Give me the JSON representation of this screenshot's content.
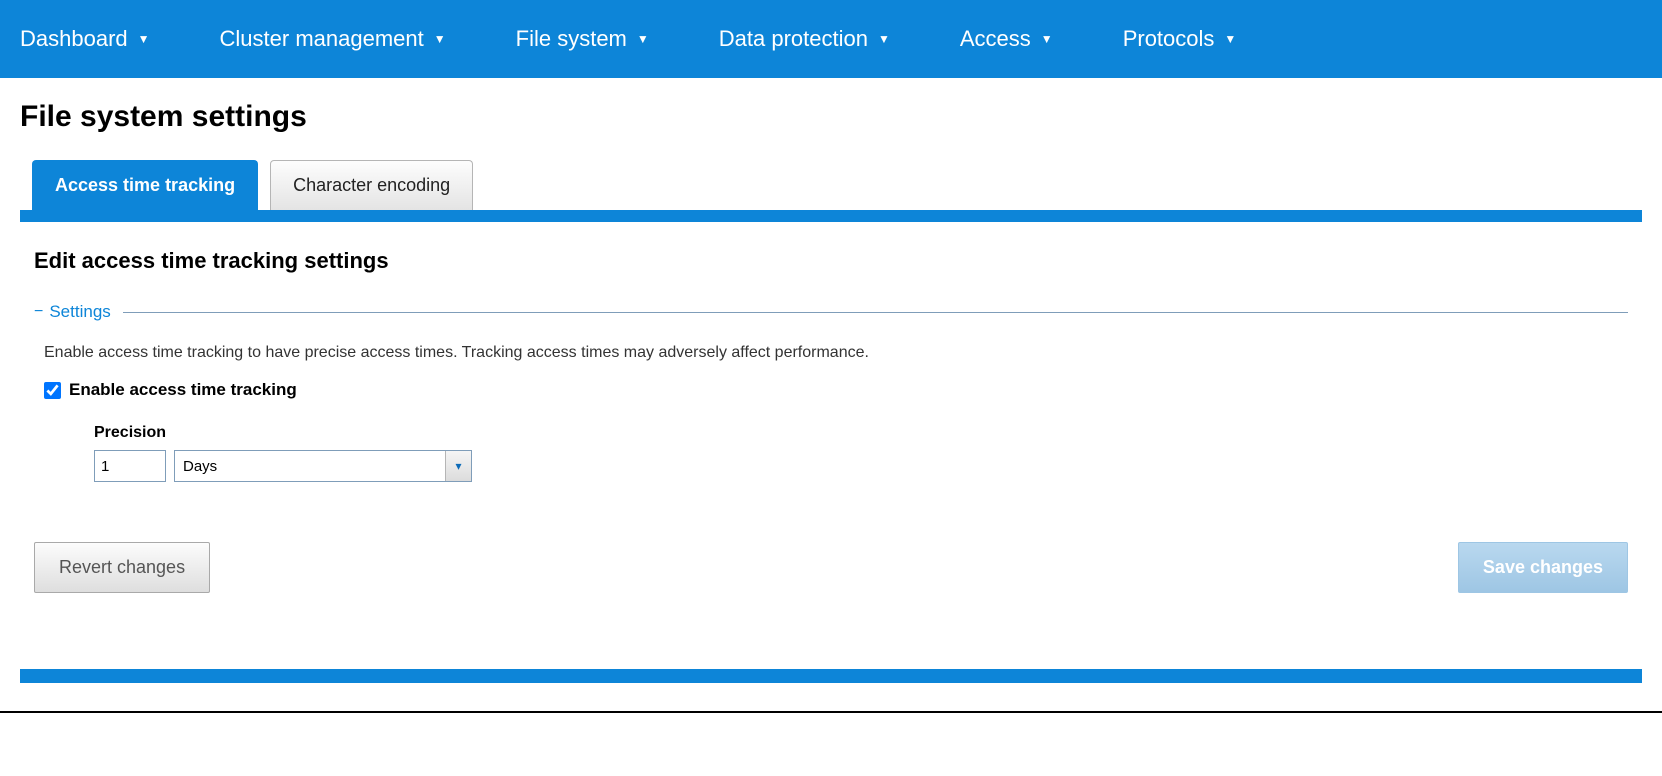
{
  "nav": {
    "items": [
      {
        "label": "Dashboard"
      },
      {
        "label": "Cluster management"
      },
      {
        "label": "File system"
      },
      {
        "label": "Data protection"
      },
      {
        "label": "Access"
      },
      {
        "label": "Protocols"
      }
    ]
  },
  "page": {
    "title": "File system settings"
  },
  "tabs": [
    {
      "label": "Access time tracking",
      "active": true
    },
    {
      "label": "Character encoding",
      "active": false
    }
  ],
  "panel": {
    "title": "Edit access time tracking settings",
    "group_label": "Settings",
    "help_text": "Enable access time tracking to have precise access times. Tracking access times may adversely affect performance.",
    "enable_checkbox_label": "Enable access time tracking",
    "enable_checkbox_checked": true,
    "precision_label": "Precision",
    "precision_value": "1",
    "precision_unit": "Days"
  },
  "buttons": {
    "revert": "Revert changes",
    "save": "Save changes"
  }
}
